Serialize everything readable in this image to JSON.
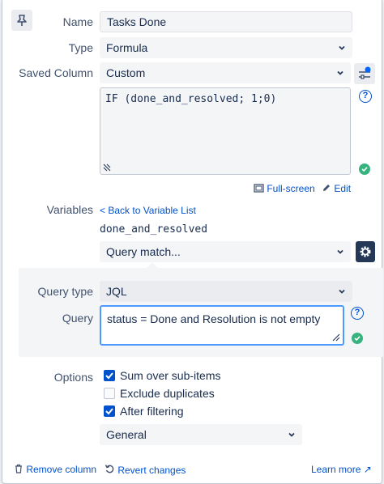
{
  "form": {
    "name_label": "Name",
    "name_value": "Tasks Done",
    "type_label": "Type",
    "type_value": "Formula",
    "saved_column_label": "Saved Column",
    "saved_column_value": "Custom",
    "formula_text": "IF (done_and_resolved; 1;0)",
    "full_screen_label": "Full-screen",
    "edit_label": "Edit",
    "help_glyph": "?"
  },
  "variables": {
    "label": "Variables",
    "back_link": "< Back to Variable List",
    "variable_name": "done_and_resolved",
    "match_type": "Query match..."
  },
  "query": {
    "query_type_label": "Query type",
    "query_type_value": "JQL",
    "query_label": "Query",
    "query_value": "status = Done and Resolution is not empty"
  },
  "options": {
    "label": "Options",
    "items": [
      {
        "label": "Sum over sub-items",
        "checked": true
      },
      {
        "label": "Exclude duplicates",
        "checked": false
      },
      {
        "label": "After filtering",
        "checked": true
      }
    ],
    "format_value": "General"
  },
  "footer": {
    "remove": "Remove column",
    "revert": "Revert changes",
    "learn_more": "Learn more ↗"
  },
  "colors": {
    "accent": "#0052cc",
    "success": "#36b37e",
    "dark_button": "#253858",
    "focus_border": "#4c9aff"
  },
  "icons": [
    "pin-icon",
    "column-settings-icon",
    "help-icon",
    "check-circle-icon",
    "fullscreen-icon",
    "edit-icon",
    "gear-icon",
    "chevron-down-icon",
    "trash-icon",
    "revert-icon"
  ]
}
